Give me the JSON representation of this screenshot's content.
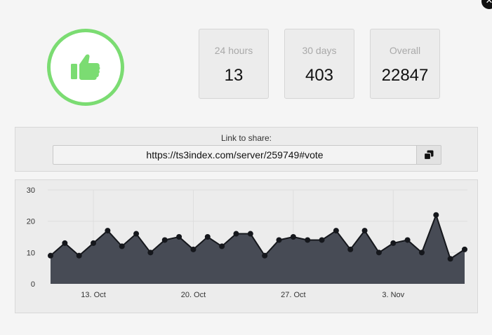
{
  "dialog": {
    "close_icon": "close-icon",
    "thumb_icon": "thumbs-up-icon",
    "accent_color": "#7bdc72"
  },
  "stats": [
    {
      "label": "24 hours",
      "value": "13"
    },
    {
      "label": "30 days",
      "value": "403"
    },
    {
      "label": "Overall",
      "value": "22847"
    }
  ],
  "share": {
    "label": "Link to share:",
    "url": "https://ts3index.com/server/259749#vote",
    "copy_icon": "copy-icon"
  },
  "chart_data": {
    "type": "area",
    "x": [
      "2019-10-10",
      "2019-10-11",
      "2019-10-12",
      "2019-10-13",
      "2019-10-14",
      "2019-10-15",
      "2019-10-16",
      "2019-10-17",
      "2019-10-18",
      "2019-10-19",
      "2019-10-20",
      "2019-10-21",
      "2019-10-22",
      "2019-10-23",
      "2019-10-24",
      "2019-10-25",
      "2019-10-26",
      "2019-10-27",
      "2019-10-28",
      "2019-10-29",
      "2019-10-30",
      "2019-10-31",
      "2019-11-01",
      "2019-11-02",
      "2019-11-03",
      "2019-11-04",
      "2019-11-05",
      "2019-11-06",
      "2019-11-07",
      "2019-11-08"
    ],
    "values": [
      9,
      13,
      9,
      13,
      17,
      12,
      16,
      10,
      14,
      15,
      11,
      15,
      12,
      16,
      16,
      9,
      14,
      15,
      14,
      14,
      17,
      11,
      17,
      10,
      13,
      14,
      10,
      22,
      8,
      11
    ],
    "x_ticks": [
      {
        "date": "2019-10-13",
        "label": "13. Oct"
      },
      {
        "date": "2019-10-20",
        "label": "20. Oct"
      },
      {
        "date": "2019-10-27",
        "label": "27. Oct"
      },
      {
        "date": "2019-11-03",
        "label": "3. Nov"
      }
    ],
    "y_ticks": [
      0,
      10,
      20,
      30
    ],
    "ylim": [
      0,
      30
    ],
    "grid": true,
    "fill_color": "#474b55",
    "line_color": "#15171c"
  }
}
